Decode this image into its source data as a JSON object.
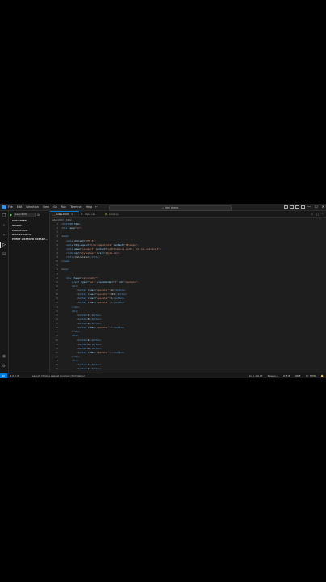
{
  "titlebar": {
    "menu": [
      "File",
      "Edit",
      "Selection",
      "View",
      "Go",
      "Run",
      "Terminal",
      "Help"
    ],
    "nav_back": "←",
    "nav_forward": "→",
    "search_text": "⌕ html demo",
    "window_controls": [
      "—",
      "☐",
      "✕"
    ]
  },
  "sidebar": {
    "run_config": "Launch Chr",
    "sections": [
      {
        "label": "VARIABLES"
      },
      {
        "label": "WATCH"
      },
      {
        "label": "CALL STACK"
      },
      {
        "label": "BREAKPOINTS"
      },
      {
        "label": "EVENT LISTENER BREAKP..."
      }
    ]
  },
  "tabs": [
    {
      "label": "index.html",
      "icon": "html-icon",
      "icon_color": "#e37933",
      "active": true
    },
    {
      "label": "style.css",
      "icon": "css-icon",
      "icon_color": "#519aba",
      "active": false
    },
    {
      "label": "script.js",
      "icon": "js-icon",
      "icon_color": "#cbcb41",
      "active": false
    }
  ],
  "breadcrumb": [
    "index.html",
    "html"
  ],
  "editor": {
    "line_numbers": [
      "1",
      "2",
      "3",
      "4",
      "5",
      "6",
      "7",
      "8",
      "9",
      "10",
      "11",
      "12",
      "13",
      "14",
      "15",
      "16",
      "17",
      "18",
      "19",
      "20",
      "21",
      "22",
      "23",
      "24",
      "25",
      "26",
      "27",
      "28",
      "29",
      "30",
      "31",
      "32",
      "33",
      "34",
      "35",
      "36"
    ],
    "lines": [
      "<!DOCTYPE html>",
      "<html lang=\"en\">",
      "",
      "<head>",
      "    <meta charset=\"UTF-8\">",
      "    <meta http-equiv=\"X-UA-Compatible\" content=\"IE=edge\">",
      "    <meta name=\"viewport\" content=\"width=device-width, initial-scale=1.0\">",
      "    <link rel=\"stylesheet\" href=\"style.css\">",
      "    <title>Calculator</title>",
      "</head>",
      "",
      "<body>",
      "",
      "    <div class=\"calculator\">",
      "        <input type=\"text\" placeholder=\"0\" id=\"inputbox\">",
      "        <div>",
      "            <button class=\"operator\">AC</button>",
      "            <button class=\"operator\">DEL</button>",
      "            <button class=\"operator\">%</button>",
      "            <button class=\"operator\">/</button>",
      "        </div>",
      "        <div>",
      "            <button>7</button>",
      "            <button>8</button>",
      "            <button>9</button>",
      "            <button class=\"operator\">*</button>",
      "        </div>",
      "        <div>",
      "            <button>4</button>",
      "            <button>5</button>",
      "            <button>6</button>",
      "            <button class=\"operator\">-</button>",
      "        </div>",
      "        <div>",
      "            <button>1</button>",
      "            <button>2</button>",
      "            <button>3</button>",
      "            <button class=\"operator\">+</button>"
    ]
  },
  "statusbar": {
    "remote_icon": "⇄",
    "left": "⊗ 0  ⚠ 0",
    "debug": "Launch Chrome against localhost (html demo)",
    "right": [
      "Ln 1, Col 17",
      "Spaces: 4",
      "UTF-8",
      "CRLF",
      "{ } HTML",
      "🔔"
    ]
  },
  "colors": {
    "accent": "#0078d4",
    "editor_bg": "#1e1e1e",
    "sidebar_bg": "#181818"
  }
}
